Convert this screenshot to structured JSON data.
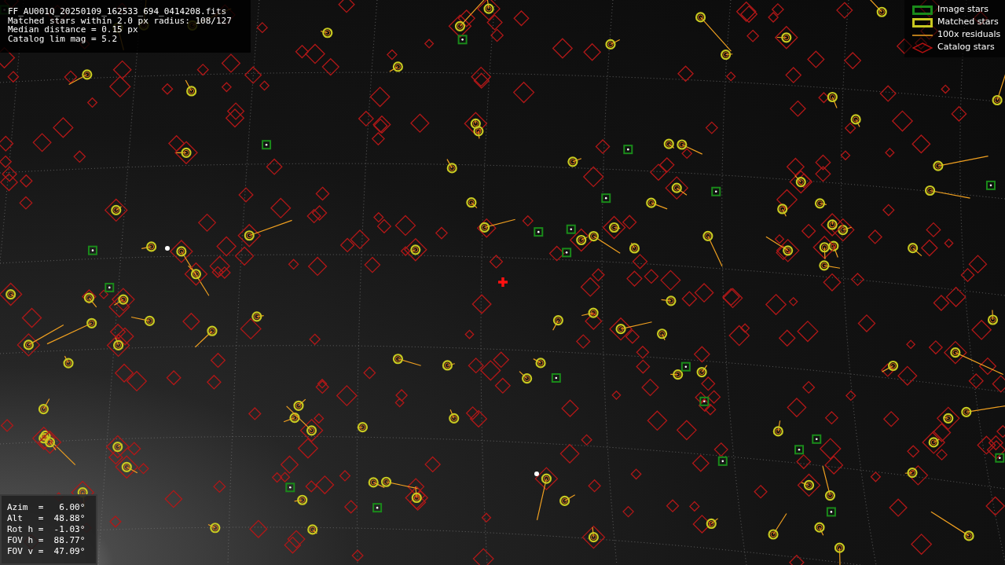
{
  "info": {
    "lines": [
      "FF_AU001Q_20250109_162533_694_0414208.fits",
      "Matched stars within 2.0 px radius: 108/127",
      "Median distance = 0.15 px",
      "Catalog lim mag = 5.2"
    ]
  },
  "legend": [
    {
      "kind": "image",
      "label": "Image stars"
    },
    {
      "kind": "matched",
      "label": "Matched stars"
    },
    {
      "kind": "residual",
      "label": "100x residuals"
    },
    {
      "kind": "catalog",
      "label": "Catalog stars"
    }
  ],
  "pointing": {
    "lines": [
      "Azim  =   6.00°",
      "Alt   =  48.88°",
      "Rot h =  -1.03°",
      "FOV h =  88.77°",
      "FOV v =  47.09°"
    ]
  }
}
